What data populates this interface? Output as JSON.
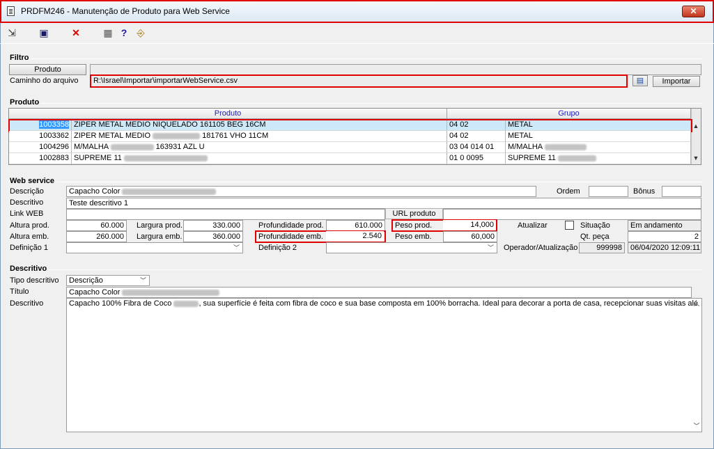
{
  "window": {
    "title": "PRDFM246 - Manutenção de Produto para Web Service",
    "close_glyph": "✕"
  },
  "toolbar": {
    "export_glyph": "⇲",
    "save_glyph": "▣",
    "delete_glyph": "✕",
    "calc_glyph": "▦",
    "help_glyph": "?",
    "exit_glyph": "⎆"
  },
  "filtro": {
    "title": "Filtro",
    "produto_button": "Produto",
    "produto_value": "",
    "caminho_label": "Caminho do arquivo",
    "caminho_value": "R:\\Israel\\Importar\\importarWebService.csv",
    "browse_glyph": "▤",
    "importar_button": "Importar"
  },
  "produto": {
    "title": "Produto",
    "headers": {
      "produto": "Produto",
      "grupo": "Grupo"
    },
    "rows": [
      {
        "code": "1003358",
        "desc": "ZIPER METAL MEDIO NIQUELADO 161105 BEG 16CM",
        "grupo_cod": "04 02",
        "grupo_desc": "METAL"
      },
      {
        "code": "1003362",
        "desc": "ZIPER METAL MEDIO",
        "desc2": "181761 VHO 11CM",
        "grupo_cod": "04 02",
        "grupo_desc": "METAL"
      },
      {
        "code": "1004296",
        "desc": "M/MALHA",
        "desc2": "163931 AZL U",
        "grupo_cod": "03 04 014 01",
        "grupo_desc": "M/MALHA"
      },
      {
        "code": "1002883",
        "desc": "SUPREME 11",
        "desc2": "",
        "grupo_cod": "01 0 0095",
        "grupo_desc": "SUPREME 11"
      }
    ],
    "scroll_up": "▲",
    "scroll_down": "▼"
  },
  "webservice": {
    "title": "Web service",
    "descricao_label": "Descrição",
    "descricao_value": "Capacho Color",
    "ordem_label": "Ordem",
    "ordem_value": "",
    "bonus_label": "Bônus",
    "bonus_value": "",
    "descritivo_label": "Descritivo",
    "descritivo_value": "Teste descritivo 1",
    "link_label": "Link WEB",
    "link_value": "",
    "url_label": "URL produto",
    "url_value": "",
    "altura_prod_label": "Altura prod.",
    "altura_prod_value": "60.000",
    "largura_prod_label": "Largura prod.",
    "largura_prod_value": "330.000",
    "prof_prod_label": "Profundidade prod.",
    "prof_prod_value": "610.000",
    "peso_prod_label": "Peso prod.",
    "peso_prod_value": "14,000",
    "atualizar_label": "Atualizar",
    "situacao_label": "Situação",
    "situacao_value": "Em andamento",
    "altura_emb_label": "Altura emb.",
    "altura_emb_value": "260.000",
    "largura_emb_label": "Largura emb.",
    "largura_emb_value": "360.000",
    "prof_emb_label": "Profundidade emb.",
    "prof_emb_value": "2.540",
    "peso_emb_label": "Peso emb.",
    "peso_emb_value": "60,000",
    "qt_peca_label": "Qt. peça",
    "qt_peca_value": "2",
    "def1_label": "Definição 1",
    "def1_value": "",
    "def2_label": "Definição 2",
    "def2_value": "",
    "operador_label": "Operador/Atualização",
    "operador_value": "999998",
    "data_value": "06/04/2020 12:09:11",
    "dd_glyph": "﹀"
  },
  "descritivo": {
    "title": "Descritivo",
    "tipo_label": "Tipo descritivo",
    "tipo_value": "Descrição",
    "titulo_label": "Título",
    "titulo_value": "Capacho Color",
    "descritivo_label": "Descritivo",
    "descritivo_value_a": "Capacho 100% Fibra de Coco",
    "descritivo_value_b": ", sua superfície é feita com fibra de coco e sua base composta em 100% borracha. Ideal para decorar a porta de casa, recepcionar suas visitas alé",
    "scroll_up": "︿",
    "scroll_down": "﹀"
  }
}
